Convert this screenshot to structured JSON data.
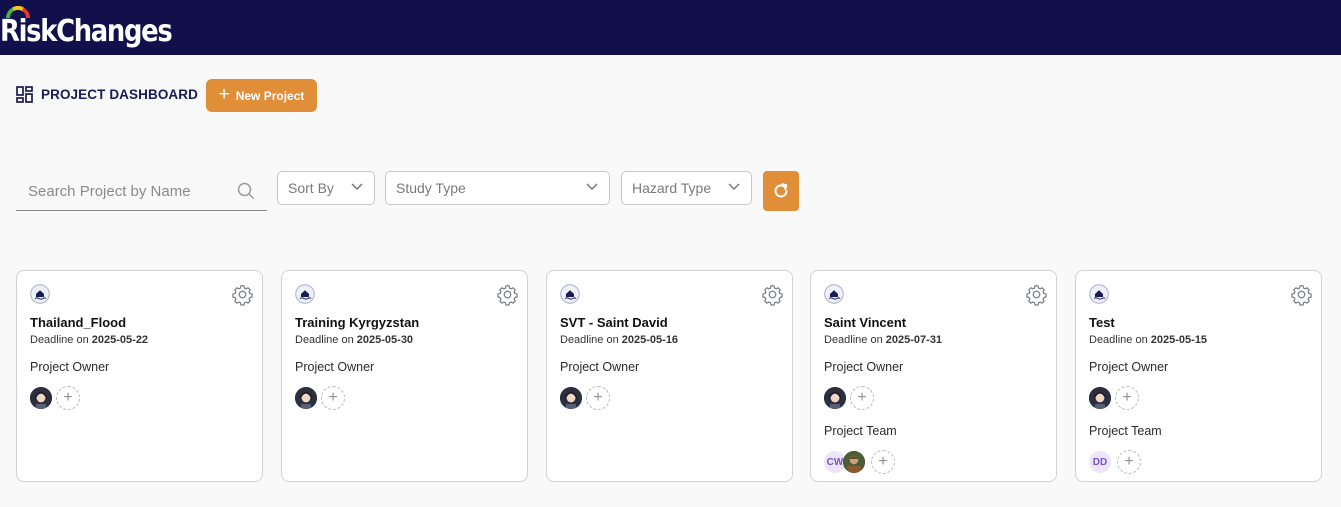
{
  "app": {
    "brand": "RiskChanges"
  },
  "dashboard": {
    "title": "PROJECT DASHBOARD",
    "new_project_label": "New Project"
  },
  "filters": {
    "search_placeholder": "Search Project by Name",
    "sort_by": "Sort By",
    "study_type": "Study Type",
    "hazard_type": "Hazard Type"
  },
  "labels": {
    "deadline_prefix": "Deadline on",
    "project_owner": "Project Owner",
    "project_team": "Project Team"
  },
  "projects": [
    {
      "name": "Thailand_Flood",
      "deadline": "2025-05-22",
      "team": []
    },
    {
      "name": "Training Kyrgyzstan",
      "deadline": "2025-05-30",
      "team": []
    },
    {
      "name": "SVT - Saint David",
      "deadline": "2025-05-16",
      "team": []
    },
    {
      "name": "Saint Vincent",
      "deadline": "2025-07-31",
      "team": [
        "CW"
      ]
    },
    {
      "name": "Test",
      "deadline": "2025-05-15",
      "team": [
        "DD"
      ]
    }
  ],
  "colors": {
    "header": "#11104a",
    "accent": "#e08e38",
    "title": "#1a1a55"
  }
}
